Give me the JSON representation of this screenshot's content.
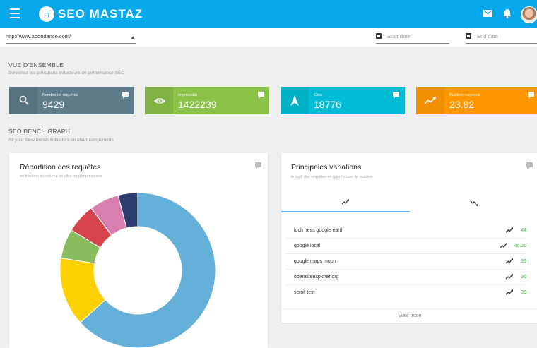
{
  "header": {
    "brand": "SEO MASTAZ",
    "menu_icon": "hamburger-icon",
    "mail_icon": "mail-icon",
    "bell_icon": "bell-icon",
    "accent_color": "#08a9ec"
  },
  "filters": {
    "url_value": "http://www.abondance.com/",
    "start_placeholder": "Start date",
    "end_placeholder": "End date"
  },
  "overview": {
    "title": "VUE D'ENSEMBLE",
    "subtitle": "Surveillez les principaux indacteurs de performance SEO"
  },
  "kpis": [
    {
      "label": "Nombre de requêtes",
      "value": "9429",
      "icon": "search-icon",
      "color": "#607d8b"
    },
    {
      "label": "Impression",
      "value": "1422239",
      "icon": "eye-icon",
      "color": "#8bc34a"
    },
    {
      "label": "Clics",
      "value": "18776",
      "icon": "cursor-icon",
      "color": "#00bcd4"
    },
    {
      "label": "Position moyenne",
      "value": "23.82",
      "icon": "trending-up-icon",
      "color": "#ff9800"
    }
  ],
  "bench": {
    "title": "SEO BENCH GRAPH",
    "subtitle": "All your SEO bench indicators on chart components"
  },
  "repartition": {
    "title": "Répartition des requêtes",
    "subtitle": "en fonction du volume de clics ou d'impressions"
  },
  "variations": {
    "title": "Principales variations",
    "subtitle": "le top5 des requêtes en gain / chute de position",
    "tabs": [
      "trending-up-icon",
      "trending-down-icon"
    ],
    "rows": [
      {
        "query": "loch ness google earth",
        "value": "44"
      },
      {
        "query": "google local",
        "value": "40.25"
      },
      {
        "query": "google maps moon",
        "value": "39"
      },
      {
        "query": "opensiteexplorer.org",
        "value": "36"
      },
      {
        "query": "scroll test",
        "value": "35"
      }
    ],
    "view_more": "View more"
  },
  "chart_data": {
    "type": "pie",
    "donut": true,
    "values": [
      62,
      14,
      6,
      6,
      6,
      4
    ],
    "colors": [
      "#64b0d9",
      "#fdd000",
      "#87bc5e",
      "#d6454e",
      "#d97fb0",
      "#2c3e70"
    ]
  }
}
